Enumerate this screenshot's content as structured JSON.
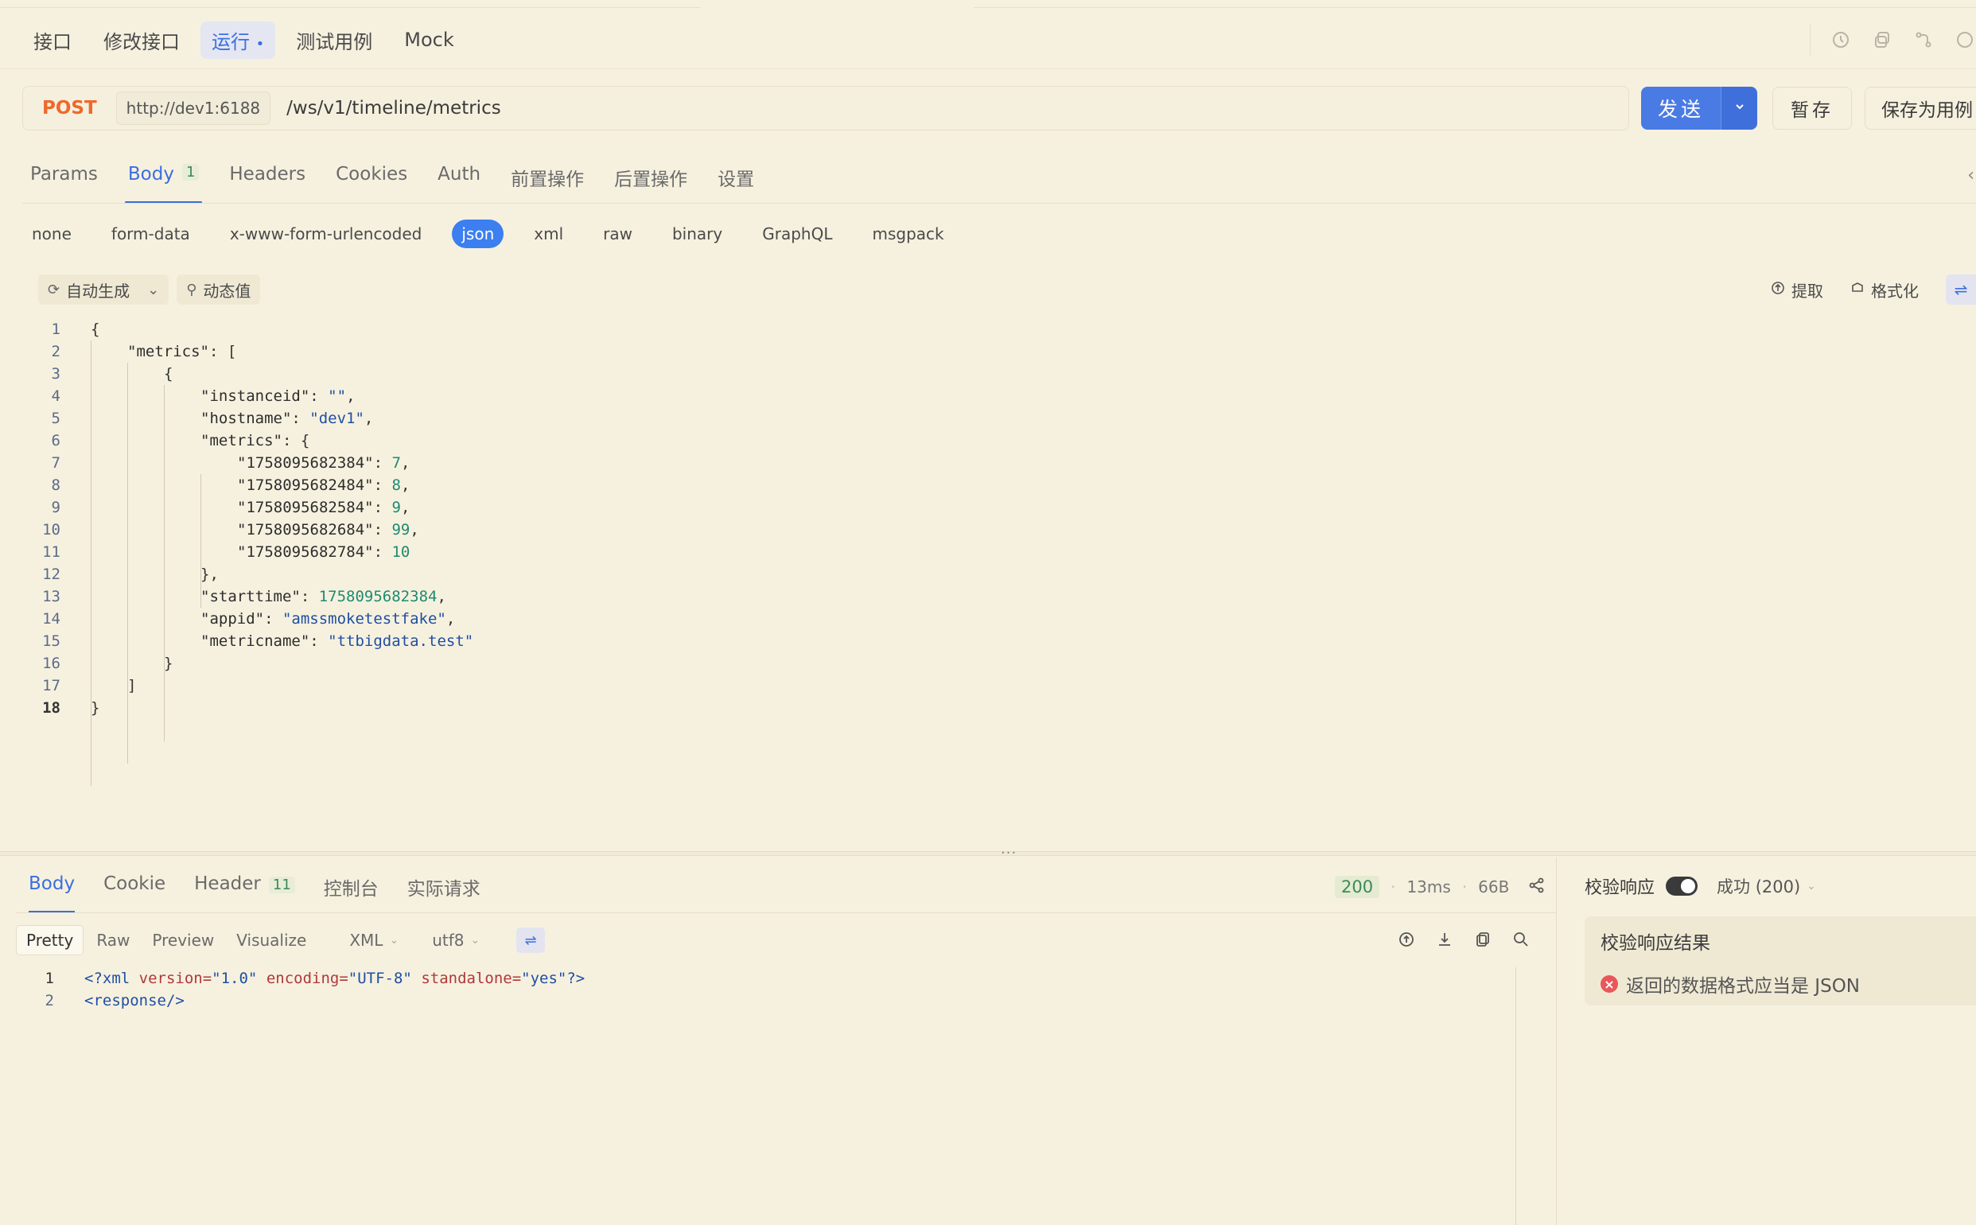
{
  "nav": {
    "tabs": [
      {
        "label": "接口"
      },
      {
        "label": "修改接口"
      },
      {
        "label": "运行",
        "dot": "•"
      },
      {
        "label": "测试用例"
      },
      {
        "label": "Mock"
      }
    ]
  },
  "request": {
    "method": "POST",
    "base_url": "http://dev1:6188",
    "path": "/ws/v1/timeline/metrics",
    "send_label": "发送",
    "save_label": "暂存",
    "save_as_label": "保存为用例"
  },
  "request_tabs": [
    {
      "label": "Params"
    },
    {
      "label": "Body",
      "badge": "1"
    },
    {
      "label": "Headers"
    },
    {
      "label": "Cookies"
    },
    {
      "label": "Auth"
    },
    {
      "label": "前置操作"
    },
    {
      "label": "后置操作"
    },
    {
      "label": "设置"
    }
  ],
  "body_types": [
    "none",
    "form-data",
    "x-www-form-urlencoded",
    "json",
    "xml",
    "raw",
    "binary",
    "GraphQL",
    "msgpack"
  ],
  "editor_toolbar": {
    "auto_generate": "自动生成",
    "dynamic_value": "动态值",
    "extract": "提取",
    "format": "格式化"
  },
  "request_body_lines": [
    "1",
    "2",
    "3",
    "4",
    "5",
    "6",
    "7",
    "8",
    "9",
    "10",
    "11",
    "12",
    "13",
    "14",
    "15",
    "16",
    "17",
    "18"
  ],
  "request_body": {
    "metrics_key": "\"metrics\"",
    "instanceid_key": "\"instanceid\"",
    "instanceid_val": "\"\"",
    "hostname_key": "\"hostname\"",
    "hostname_val": "\"dev1\"",
    "inner_metrics_key": "\"metrics\"",
    "m1_key": "\"1758095682384\"",
    "m1_val": "7",
    "m2_key": "\"1758095682484\"",
    "m2_val": "8",
    "m3_key": "\"1758095682584\"",
    "m3_val": "9",
    "m4_key": "\"1758095682684\"",
    "m4_val": "99",
    "m5_key": "\"1758095682784\"",
    "m5_val": "10",
    "starttime_key": "\"starttime\"",
    "starttime_val": "1758095682384",
    "appid_key": "\"appid\"",
    "appid_val": "\"amssmoketestfake\"",
    "metricname_key": "\"metricname\"",
    "metricname_val": "\"ttbigdata.test\""
  },
  "response_tabs": [
    {
      "label": "Body"
    },
    {
      "label": "Cookie"
    },
    {
      "label": "Header",
      "badge": "11"
    },
    {
      "label": "控制台"
    },
    {
      "label": "实际请求"
    }
  ],
  "response_meta": {
    "status": "200",
    "time": "13ms",
    "size": "66B"
  },
  "view_modes": [
    "Pretty",
    "Raw",
    "Preview",
    "Visualize"
  ],
  "format_select": "XML",
  "encoding_select": "utf8",
  "response_body": {
    "line1": "1",
    "line2": "2",
    "xml_open": "<?xml",
    "version_attr": "version=",
    "version_val": "\"1.0\"",
    "encoding_attr": "encoding=",
    "encoding_val": "\"UTF-8\"",
    "standalone_attr": "standalone=",
    "standalone_val": "\"yes\"",
    "xml_close": "?>",
    "response_tag": "<response/>"
  },
  "validation": {
    "label": "校验响应",
    "status": "成功 (200)",
    "title": "校验响应结果",
    "message": "返回的数据格式应当是 JSON"
  },
  "colors": {
    "accent": "#3b6fe0",
    "method": "#f0682c",
    "background": "#f6f1df",
    "error": "#e9575a"
  }
}
